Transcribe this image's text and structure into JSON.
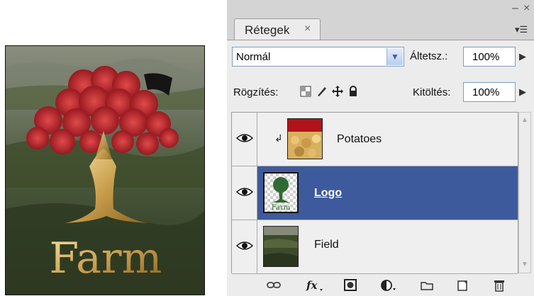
{
  "composite": {
    "title": "Farm"
  },
  "panel": {
    "tab_label": "Rétegek",
    "tab_close": "×",
    "minimize": "–",
    "close": "×",
    "menu": "▾☰",
    "blend_mode": "Normál",
    "opacity_label": "Áltetsz.:",
    "opacity_value": "100%",
    "lock_label": "Rögzítés:",
    "fill_label": "Kitöltés:",
    "fill_value": "100%",
    "step_arrow": "▶",
    "dropdown_arrow": "▼",
    "clip_arrow": "↲",
    "scroll_up": "▲",
    "scroll_down": "▼"
  },
  "layers": [
    {
      "name": "Potatoes",
      "visible": true,
      "clipped": true,
      "selected": false
    },
    {
      "name": "Logo",
      "visible": true,
      "clipped": false,
      "selected": true,
      "thumb_text": "Farm"
    },
    {
      "name": "Field",
      "visible": true,
      "clipped": false,
      "selected": false
    }
  ],
  "footer_icons": [
    "link-layers-icon",
    "fx-icon",
    "layer-mask-icon",
    "adjustment-layer-icon",
    "new-group-icon",
    "new-layer-icon",
    "delete-layer-icon"
  ],
  "colors": {
    "selected": "#3d5b9c",
    "tree_red": "#c0262e",
    "gold": "#d9b15a"
  }
}
